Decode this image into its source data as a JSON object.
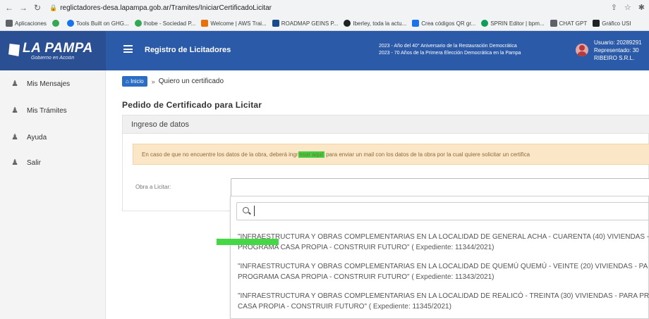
{
  "browser": {
    "url": "reglictadores-desa.lapampa.gob.ar/Tramites/IniciarCertificadoLicitar",
    "bookmarks": [
      {
        "label": "Aplicaciones",
        "color": "#5f6368"
      },
      {
        "label": "",
        "color": "#34a853"
      },
      {
        "label": "Tools Built on GHG...",
        "color": "#1a73e8"
      },
      {
        "label": "Ihobe - Sociedad P...",
        "color": "#34a853"
      },
      {
        "label": "Welcome | AWS Trai...",
        "color": "#e8710a"
      },
      {
        "label": "ROADMAP GEINS P...",
        "color": "#1a4a8a"
      },
      {
        "label": "Iberley, toda la actu...",
        "color": "#202124"
      },
      {
        "label": "Crea códigos QR gr...",
        "color": "#1a73e8"
      },
      {
        "label": "SPRIN Editor | bpm...",
        "color": "#0f9d58"
      },
      {
        "label": "CHAT GPT",
        "color": "#5f6368"
      },
      {
        "label": "Gráfico USI",
        "color": "#202124"
      }
    ]
  },
  "header": {
    "logo_text": "LA PAMPA",
    "logo_sub": "Gobierno en Acción",
    "app_title": "Registro de Licitadores",
    "notice_line1": "2023 - Año del 40° Aniversario de la Restauración Democrática",
    "notice_line2": "2023 - 70 Años de la Primera Elección Democrática en la Pampa",
    "user_line1": "Usuario: 20289291",
    "user_line2": "Representado: 30",
    "user_line3": "RIBEIRO S.R.L."
  },
  "sidebar": {
    "items": [
      {
        "label": "Mis Mensajes"
      },
      {
        "label": "Mis Trámites"
      },
      {
        "label": "Ayuda"
      },
      {
        "label": "Salir"
      }
    ]
  },
  "breadcrumb": {
    "home": "Inicio",
    "separator": "»",
    "current": "Quiero un certificado"
  },
  "page": {
    "title": "Pedido de Certificado para Licitar",
    "card_title": "Ingreso de datos",
    "alert_before": "En caso de que no encuentre los datos de la obra, deberá ingr",
    "alert_link": "esar aquí",
    "alert_after": " para enviar un mail con los datos de la obra por la cual quiere solicitar un certifica",
    "obra_label": "Obra a Licitar:"
  },
  "dropdown": {
    "search_placeholder": "",
    "options": [
      {
        "line1": "\"INFRAESTRUCTURA Y OBRAS COMPLEMENTARIAS EN LA LOCALIDAD DE GENERAL ACHA - CUARENTA (40) VIVIENDAS -",
        "line2": "PROGRAMA CASA PROPIA - CONSTRUIR FUTURO\" ( Expediente: 11344/2021)"
      },
      {
        "line1": "\"INFRAESTRUCTURA Y OBRAS COMPLEMENTARIAS EN LA LOCALIDAD DE QUEMÚ QUEMÚ - VEINTE (20) VIVIENDAS - PA",
        "line2": "PROGRAMA CASA PROPIA - CONSTRUIR FUTURO\" ( Expediente: 11343/2021)"
      },
      {
        "line1": "\"INFRAESTRUCTURA Y OBRAS COMPLEMENTARIAS EN LA LOCALIDAD DE REALICÓ - TREINTA (30) VIVIENDAS - PARA PR",
        "line2": "CASA PROPIA - CONSTRUIR FUTURO\" ( Expediente: 11345/2021)"
      }
    ]
  },
  "colors": {
    "header_blue": "#2b5aa8",
    "highlight_green": "#45d745",
    "alert_bg": "#fbe6c8"
  }
}
